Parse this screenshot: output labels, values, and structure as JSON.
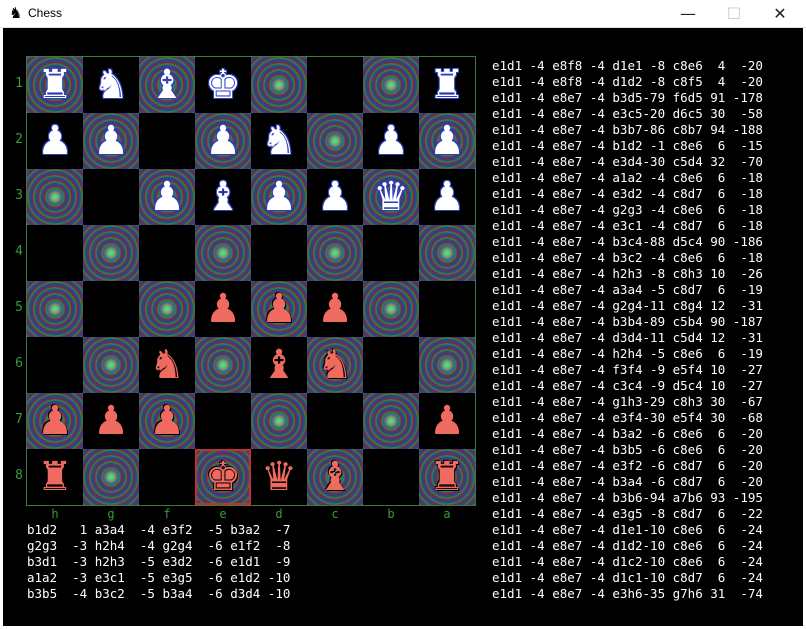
{
  "window": {
    "title": "Chess",
    "app_icon": "chess-knight-icon",
    "minimize": "—",
    "maximize": "☐",
    "close": "✕"
  },
  "board": {
    "ranks": [
      "1",
      "2",
      "3",
      "4",
      "5",
      "6",
      "7",
      "8"
    ],
    "files": [
      "h",
      "g",
      "f",
      "e",
      "d",
      "c",
      "b",
      "a"
    ],
    "squares": [
      [
        {
          "p": "♜",
          "c": "w",
          "n": "white-rook-icon"
        },
        {
          "p": "♞",
          "c": "w",
          "n": "white-knight-icon"
        },
        {
          "p": "♝",
          "c": "w",
          "n": "white-bishop-icon"
        },
        {
          "p": "♚",
          "c": "w",
          "n": "white-king-icon"
        },
        {
          "p": "",
          "c": "",
          "n": ""
        },
        {
          "p": "",
          "c": "",
          "n": ""
        },
        {
          "p": "",
          "c": "",
          "n": ""
        },
        {
          "p": "♜",
          "c": "w",
          "n": "white-rook-icon"
        }
      ],
      [
        {
          "p": "♟",
          "c": "w",
          "n": "white-pawn-icon"
        },
        {
          "p": "♟",
          "c": "w",
          "n": "white-pawn-icon"
        },
        {
          "p": "",
          "c": "",
          "n": ""
        },
        {
          "p": "♟",
          "c": "w",
          "n": "white-pawn-icon"
        },
        {
          "p": "♞",
          "c": "w",
          "n": "white-knight-icon"
        },
        {
          "p": "",
          "c": "",
          "n": ""
        },
        {
          "p": "♟",
          "c": "w",
          "n": "white-pawn-icon"
        },
        {
          "p": "♟",
          "c": "w",
          "n": "white-pawn-icon"
        }
      ],
      [
        {
          "p": "",
          "c": "",
          "n": ""
        },
        {
          "p": "",
          "c": "",
          "n": ""
        },
        {
          "p": "♟",
          "c": "w",
          "n": "white-pawn-icon"
        },
        {
          "p": "♝",
          "c": "w",
          "n": "white-bishop-icon"
        },
        {
          "p": "♟",
          "c": "w",
          "n": "white-pawn-icon"
        },
        {
          "p": "♟",
          "c": "w",
          "n": "white-pawn-icon"
        },
        {
          "p": "♛",
          "c": "w",
          "n": "white-queen-icon"
        },
        {
          "p": "♟",
          "c": "w",
          "n": "white-pawn-icon"
        }
      ],
      [
        {
          "p": "",
          "c": "",
          "n": ""
        },
        {
          "p": "",
          "c": "",
          "n": ""
        },
        {
          "p": "",
          "c": "",
          "n": ""
        },
        {
          "p": "",
          "c": "",
          "n": ""
        },
        {
          "p": "",
          "c": "",
          "n": ""
        },
        {
          "p": "",
          "c": "",
          "n": ""
        },
        {
          "p": "",
          "c": "",
          "n": ""
        },
        {
          "p": "",
          "c": "",
          "n": ""
        }
      ],
      [
        {
          "p": "",
          "c": "",
          "n": ""
        },
        {
          "p": "",
          "c": "",
          "n": ""
        },
        {
          "p": "",
          "c": "",
          "n": ""
        },
        {
          "p": "♟",
          "c": "b",
          "n": "black-pawn-icon"
        },
        {
          "p": "♟",
          "c": "b",
          "n": "black-pawn-icon"
        },
        {
          "p": "♟",
          "c": "b",
          "n": "black-pawn-icon"
        },
        {
          "p": "",
          "c": "",
          "n": ""
        },
        {
          "p": "",
          "c": "",
          "n": ""
        }
      ],
      [
        {
          "p": "",
          "c": "",
          "n": ""
        },
        {
          "p": "",
          "c": "",
          "n": ""
        },
        {
          "p": "♞",
          "c": "b",
          "n": "black-knight-icon"
        },
        {
          "p": "",
          "c": "",
          "n": ""
        },
        {
          "p": "♝",
          "c": "b",
          "n": "black-bishop-icon"
        },
        {
          "p": "♞",
          "c": "b",
          "n": "black-knight-icon"
        },
        {
          "p": "",
          "c": "",
          "n": ""
        },
        {
          "p": "",
          "c": "",
          "n": ""
        }
      ],
      [
        {
          "p": "♟",
          "c": "b",
          "n": "black-pawn-icon"
        },
        {
          "p": "♟",
          "c": "b",
          "n": "black-pawn-icon"
        },
        {
          "p": "♟",
          "c": "b",
          "n": "black-pawn-icon"
        },
        {
          "p": "",
          "c": "",
          "n": ""
        },
        {
          "p": "",
          "c": "",
          "n": ""
        },
        {
          "p": "",
          "c": "",
          "n": ""
        },
        {
          "p": "",
          "c": "",
          "n": ""
        },
        {
          "p": "♟",
          "c": "b",
          "n": "black-pawn-icon"
        }
      ],
      [
        {
          "p": "♜",
          "c": "b",
          "n": "black-rook-icon"
        },
        {
          "p": "",
          "c": "",
          "n": ""
        },
        {
          "p": "",
          "c": "",
          "n": ""
        },
        {
          "p": "♚",
          "c": "b",
          "n": "black-king-icon"
        },
        {
          "p": "♛",
          "c": "b",
          "n": "black-queen-icon"
        },
        {
          "p": "♝",
          "c": "b",
          "n": "black-bishop-icon"
        },
        {
          "p": "",
          "c": "",
          "n": ""
        },
        {
          "p": "♜",
          "c": "b",
          "n": "black-rook-icon"
        }
      ]
    ],
    "highlighted_square": "e8",
    "colors": {
      "white_piece": "#ffffff",
      "white_outline": "#2a3fc0",
      "black_piece": "#f06a60",
      "coords": "#3c9a3c",
      "highlight": "#c43030"
    }
  },
  "moves_left": [
    "b1d2   1 a3a4  -4 e3f2  -5 b3a2  -7",
    "g2g3  -3 h2h4  -4 g2g4  -6 e1f2  -8",
    "b3d1  -3 h2h3  -5 e3d2  -6 e1d1  -9",
    "a1a2  -3 e3c1  -5 e3g5  -6 e1d2 -10",
    "b3b5  -4 b3c2  -5 b3a4  -6 d3d4 -10"
  ],
  "moves_right": [
    "e1d1 -4 e8f8 -4 d1e1 -8 c8e6  4  -20",
    "e1d1 -4 e8f8 -4 d1d2 -8 c8f5  4  -20",
    "e1d1 -4 e8e7 -4 b3d5-79 f6d5 91 -178",
    "e1d1 -4 e8e7 -4 e3c5-20 d6c5 30  -58",
    "e1d1 -4 e8e7 -4 b3b7-86 c8b7 94 -188",
    "e1d1 -4 e8e7 -4 b1d2 -1 c8e6  6  -15",
    "e1d1 -4 e8e7 -4 e3d4-30 c5d4 32  -70",
    "e1d1 -4 e8e7 -4 a1a2 -4 c8e6  6  -18",
    "e1d1 -4 e8e7 -4 e3d2 -4 c8d7  6  -18",
    "e1d1 -4 e8e7 -4 g2g3 -4 c8e6  6  -18",
    "e1d1 -4 e8e7 -4 e3c1 -4 c8d7  6  -18",
    "e1d1 -4 e8e7 -4 b3c4-88 d5c4 90 -186",
    "e1d1 -4 e8e7 -4 b3c2 -4 c8e6  6  -18",
    "e1d1 -4 e8e7 -4 h2h3 -8 c8h3 10  -26",
    "e1d1 -4 e8e7 -4 a3a4 -5 c8d7  6  -19",
    "e1d1 -4 e8e7 -4 g2g4-11 c8g4 12  -31",
    "e1d1 -4 e8e7 -4 b3b4-89 c5b4 90 -187",
    "e1d1 -4 e8e7 -4 d3d4-11 c5d4 12  -31",
    "e1d1 -4 e8e7 -4 h2h4 -5 c8e6  6  -19",
    "e1d1 -4 e8e7 -4 f3f4 -9 e5f4 10  -27",
    "e1d1 -4 e8e7 -4 c3c4 -9 d5c4 10  -27",
    "e1d1 -4 e8e7 -4 g1h3-29 c8h3 30  -67",
    "e1d1 -4 e8e7 -4 e3f4-30 e5f4 30  -68",
    "e1d1 -4 e8e7 -4 b3a2 -6 c8e6  6  -20",
    "e1d1 -4 e8e7 -4 b3b5 -6 c8e6  6  -20",
    "e1d1 -4 e8e7 -4 e3f2 -6 c8d7  6  -20",
    "e1d1 -4 e8e7 -4 b3a4 -6 c8d7  6  -20",
    "e1d1 -4 e8e7 -4 b3b6-94 a7b6 93 -195",
    "e1d1 -4 e8e7 -4 e3g5 -8 c8d7  6  -22",
    "e1d1 -4 e8e7 -4 d1e1-10 c8e6  6  -24",
    "e1d1 -4 e8e7 -4 d1d2-10 c8e6  6  -24",
    "e1d1 -4 e8e7 -4 d1c2-10 c8e6  6  -24",
    "e1d1 -4 e8e7 -4 d1c1-10 c8d7  6  -24",
    "e1d1 -4 e8e7 -4 e3h6-35 g7h6 31  -74"
  ]
}
